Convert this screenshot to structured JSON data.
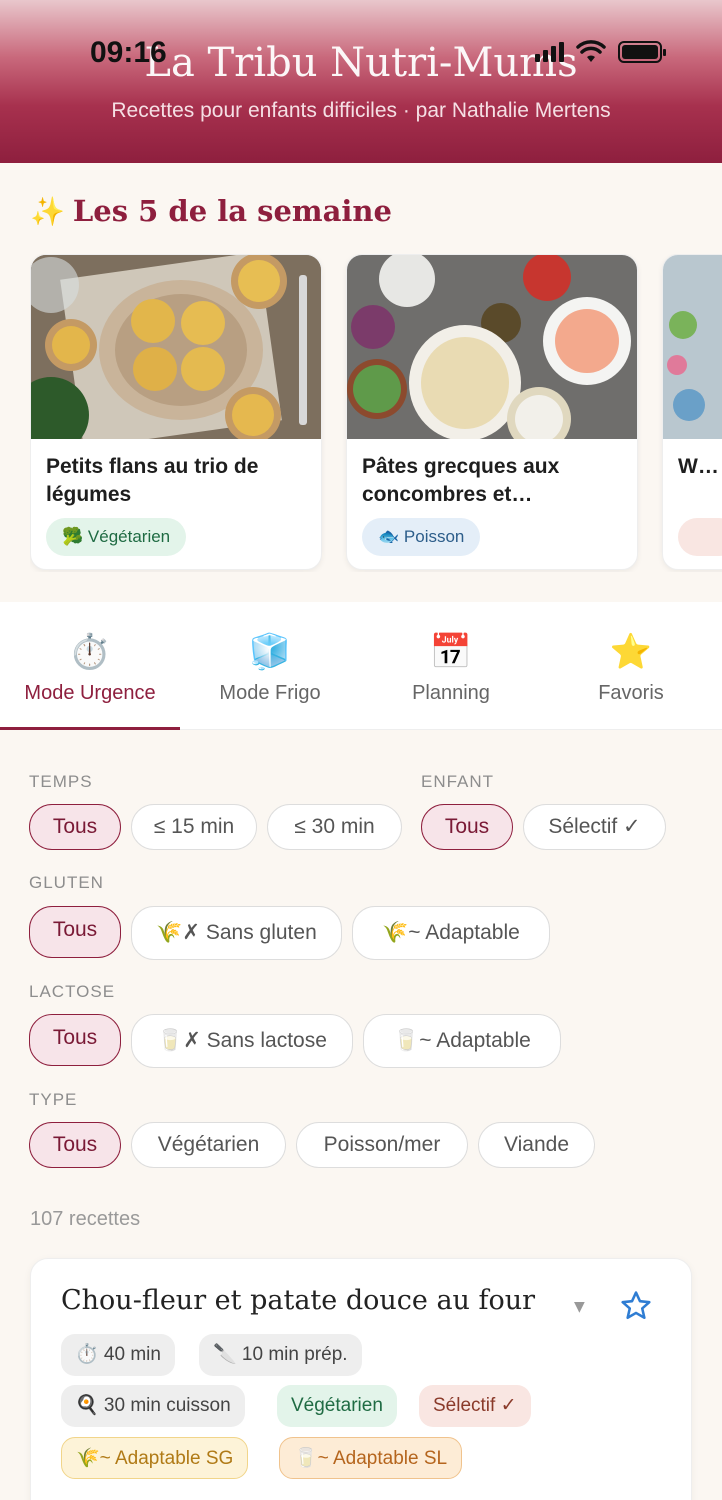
{
  "status_bar": {
    "time": "09:16"
  },
  "header": {
    "title": "La Tribu Nutri-Mums",
    "subtitle": "Recettes pour enfants difficiles · par Nathalie Mertens"
  },
  "weekly": {
    "icon": "✨",
    "title": "Les 5 de la semaine",
    "cards": [
      {
        "name": "Petits flans au trio de légumes",
        "tag_icon": "🥦",
        "tag": "Végétarien"
      },
      {
        "name": "Pâtes grecques aux concombres et…",
        "tag_icon": "🐟",
        "tag": "Poisson"
      },
      {
        "name": "W… h…"
      }
    ]
  },
  "tabs": [
    {
      "icon": "⏱️",
      "label": "Mode Urgence",
      "active": true
    },
    {
      "icon": "🧊",
      "label": "Mode Frigo"
    },
    {
      "icon": "📅",
      "label": "Planning"
    },
    {
      "icon": "⭐",
      "label": "Favoris"
    }
  ],
  "filters": {
    "temps": {
      "label": "TEMPS",
      "options": [
        "Tous",
        "≤ 15 min",
        "≤ 30 min"
      ],
      "selected": "Tous"
    },
    "enfant": {
      "label": "ENFANT",
      "options": [
        "Tous",
        "Sélectif ✓"
      ],
      "selected": "Tous"
    },
    "gluten": {
      "label": "GLUTEN",
      "options": [
        "Tous",
        "🌾✗ Sans gluten",
        "🌾~ Adaptable"
      ],
      "selected": "Tous"
    },
    "lactose": {
      "label": "LACTOSE",
      "options": [
        "Tous",
        "🥛✗ Sans lactose",
        "🥛~ Adaptable"
      ],
      "selected": "Tous"
    },
    "type": {
      "label": "TYPE",
      "options": [
        "Tous",
        "Végétarien",
        "Poisson/mer",
        "Viande"
      ],
      "selected": "Tous"
    }
  },
  "results": {
    "count_text": "107 recettes"
  },
  "recipe": {
    "title": "Chou-fleur et patate douce au four",
    "caret": "▼",
    "pills": [
      "⏱️ 40 min",
      "🔪 10 min prép.",
      "🍳 30 min cuisson",
      "Végétarien",
      "Sélectif ✓",
      "🌾~ Adaptable SG",
      "🥛~ Adaptable SL"
    ]
  },
  "colors": {
    "brand": "#8e1f3e",
    "favorite_star": "#2f7dd3",
    "background": "#fbf7f2"
  }
}
